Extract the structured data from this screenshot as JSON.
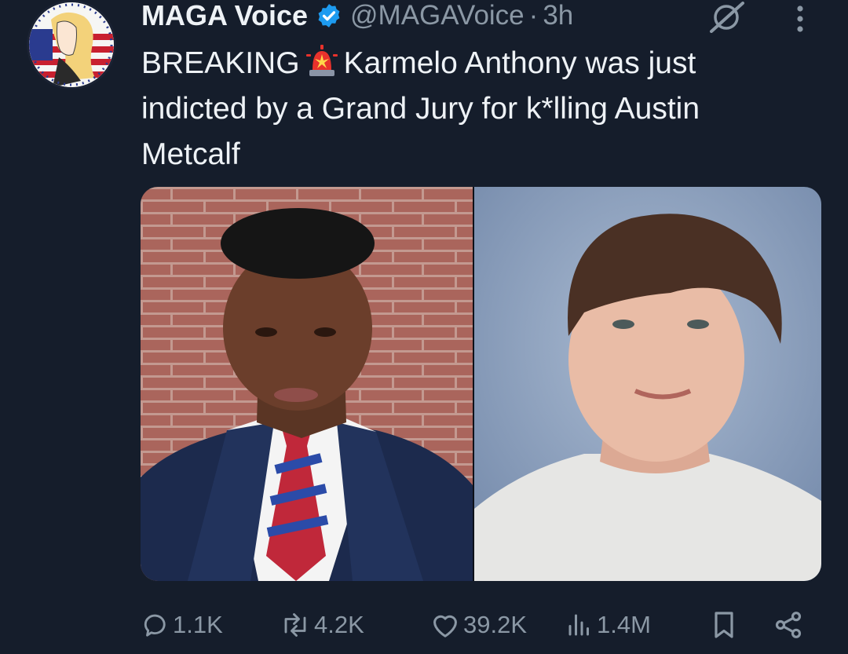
{
  "tweet": {
    "author_name": "MAGA Voice",
    "handle": "@MAGAVoice",
    "separator": "·",
    "time": "3h",
    "text_line1_a": "BREAKING",
    "text_line1_b": "Karmelo Anthony was just",
    "text_line2": "indicted by a Grand Jury for k*lling Austin",
    "text_line3": "Metcalf"
  },
  "icons": {
    "verified": "verified-badge-icon",
    "siren": "rotating-light-emoji",
    "grok": "grok-icon",
    "more": "more-vertical-icon",
    "reply": "reply-icon",
    "retweet": "retweet-icon",
    "like": "heart-icon",
    "views": "views-chart-icon",
    "bookmark": "bookmark-icon",
    "share": "share-icon"
  },
  "stats": {
    "replies": "1.1K",
    "retweets": "4.2K",
    "likes": "39.2K",
    "views": "1.4M"
  },
  "colors": {
    "background": "#151d2b",
    "text": "#eef2f6",
    "muted": "#8b98a5",
    "verified": "#1d9bf0"
  }
}
